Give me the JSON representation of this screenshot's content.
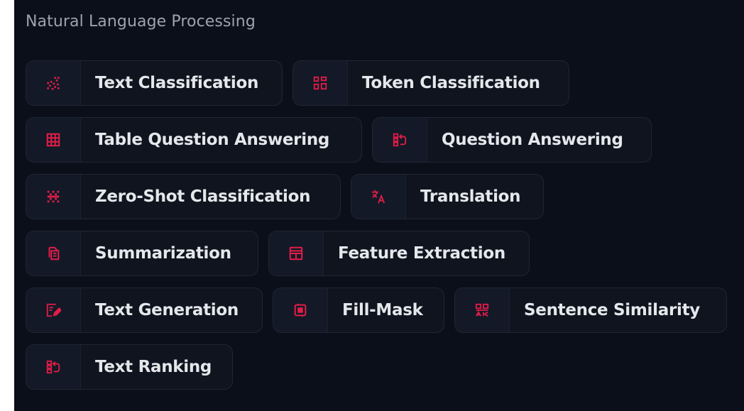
{
  "section": {
    "title": "Natural Language Processing"
  },
  "colors": {
    "panel_bg": "#0b0f19",
    "chip_bg": "#0f141f",
    "chip_border": "#1f2633",
    "icon_red": "#e11d48",
    "label": "#e5e7eb",
    "title": "#9ca3af"
  },
  "rows": [
    [
      {
        "label": "Text Classification",
        "icon": "text-classification-icon"
      },
      {
        "label": "Token Classification",
        "icon": "token-classification-icon"
      }
    ],
    [
      {
        "label": "Table Question Answering",
        "icon": "table-icon"
      },
      {
        "label": "Question Answering",
        "icon": "question-answering-icon"
      }
    ],
    [
      {
        "label": "Zero-Shot Classification",
        "icon": "zero-shot-icon"
      },
      {
        "label": "Translation",
        "icon": "translation-icon"
      }
    ],
    [
      {
        "label": "Summarization",
        "icon": "summarization-icon"
      },
      {
        "label": "Feature Extraction",
        "icon": "feature-extraction-icon"
      }
    ],
    [
      {
        "label": "Text Generation",
        "icon": "text-generation-icon"
      },
      {
        "label": "Fill-Mask",
        "icon": "fill-mask-icon"
      },
      {
        "label": "Sentence Similarity",
        "icon": "sentence-similarity-icon"
      }
    ],
    [
      {
        "label": "Text Ranking",
        "icon": "text-ranking-icon"
      }
    ]
  ]
}
